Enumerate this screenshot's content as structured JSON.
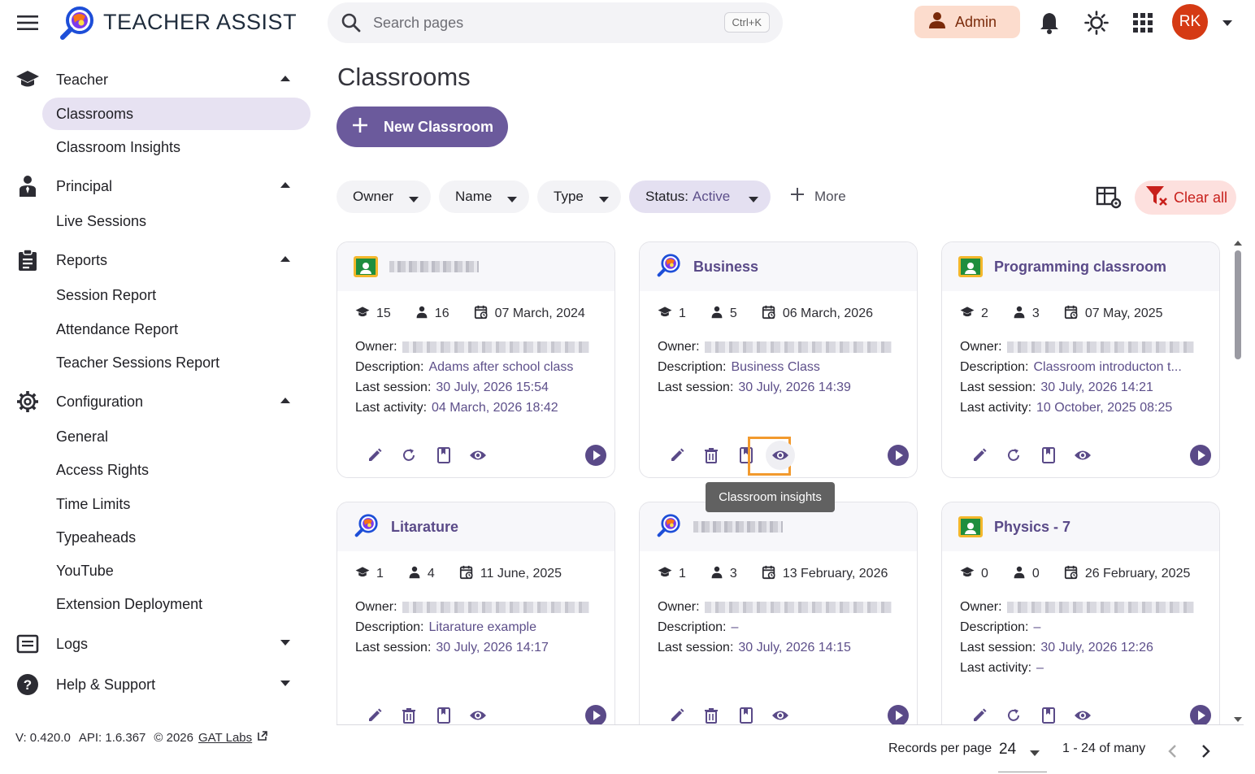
{
  "app": {
    "title": "TEACHER ASSIST",
    "search_placeholder": "Search pages",
    "search_shortcut": "Ctrl+K",
    "role_label": "Admin",
    "avatar_initials": "RK"
  },
  "sidebar": {
    "sections": [
      {
        "label": "Teacher",
        "icon": "graduation-cap-icon",
        "expanded": true,
        "items": [
          "Classrooms",
          "Classroom Insights"
        ]
      },
      {
        "label": "Principal",
        "icon": "person-icon",
        "expanded": true,
        "items": [
          "Live Sessions"
        ]
      },
      {
        "label": "Reports",
        "icon": "clipboard-icon",
        "expanded": true,
        "items": [
          "Session Report",
          "Attendance Report",
          "Teacher Sessions Report"
        ]
      },
      {
        "label": "Configuration",
        "icon": "gear-icon",
        "expanded": true,
        "items": [
          "General",
          "Access Rights",
          "Time Limits",
          "Typeaheads",
          "YouTube",
          "Extension Deployment"
        ]
      },
      {
        "label": "Logs",
        "icon": "list-box-icon",
        "expanded": false,
        "items": []
      },
      {
        "label": "Help & Support",
        "icon": "help-circle-icon",
        "expanded": false,
        "items": []
      }
    ],
    "active_item": "Classrooms",
    "version": "V: 0.420.0",
    "api": "API: 1.6.367",
    "copyright": "© 2026",
    "company": "GAT Labs"
  },
  "main": {
    "title": "Classrooms",
    "new_button": "New Classroom",
    "filters": [
      {
        "label": "Owner"
      },
      {
        "label": "Name"
      },
      {
        "label": "Type"
      },
      {
        "label": "Status:",
        "value": "Active"
      }
    ],
    "more_label": "More",
    "clear_all_label": "Clear all",
    "tooltip": "Classroom insights"
  },
  "cards": [
    {
      "title": "",
      "redacted": true,
      "type": "google",
      "classes": "15",
      "students": "16",
      "date": "07 March, 2024",
      "owner_label": "Owner:",
      "description_label": "Description:",
      "description": "Adams after school class",
      "last_session_label": "Last session:",
      "last_session": "30 July, 2026 15:54",
      "last_activity_label": "Last activity:",
      "last_activity": "04 March, 2026 18:42",
      "second_action": "refresh"
    },
    {
      "title": "Business",
      "redacted": false,
      "type": "local",
      "classes": "1",
      "students": "5",
      "date": "06 March, 2026",
      "owner_label": "Owner:",
      "description_label": "Description:",
      "description": "Business Class",
      "last_session_label": "Last session:",
      "last_session": "30 July, 2026 14:39",
      "last_activity_label": "",
      "last_activity": "",
      "second_action": "delete"
    },
    {
      "title": "Programming classroom",
      "redacted": false,
      "type": "google",
      "classes": "2",
      "students": "3",
      "date": "07 May, 2025",
      "owner_label": "Owner:",
      "description_label": "Description:",
      "description": "Classroom introducton t...",
      "last_session_label": "Last session:",
      "last_session": "30 July, 2026 14:21",
      "last_activity_label": "Last activity:",
      "last_activity": "10 October, 2025 08:25",
      "second_action": "refresh"
    },
    {
      "title": "Litarature",
      "redacted": false,
      "type": "local",
      "classes": "1",
      "students": "4",
      "date": "11 June, 2025",
      "owner_label": "Owner:",
      "description_label": "Description:",
      "description": "Litarature example",
      "last_session_label": "Last session:",
      "last_session": "30 July, 2026 14:17",
      "last_activity_label": "",
      "last_activity": "",
      "second_action": "delete"
    },
    {
      "title": "",
      "redacted": true,
      "type": "local",
      "classes": "1",
      "students": "3",
      "date": "13 February, 2026",
      "owner_label": "Owner:",
      "description_label": "Description:",
      "description": "–",
      "last_session_label": "Last session:",
      "last_session": "30 July, 2026 14:15",
      "last_activity_label": "",
      "last_activity": "",
      "second_action": "delete"
    },
    {
      "title": "Physics - 7",
      "redacted": false,
      "type": "google",
      "classes": "0",
      "students": "0",
      "date": "26 February, 2025",
      "owner_label": "Owner:",
      "description_label": "Description:",
      "description": "–",
      "last_session_label": "Last session:",
      "last_session": "30 July, 2026 12:26",
      "last_activity_label": "Last activity:",
      "last_activity": "–",
      "second_action": "refresh"
    }
  ],
  "pagination": {
    "records_label": "Records per page",
    "per_page": "24",
    "range": "1 - 24 of many"
  },
  "colors": {
    "accent": "#6b5a9c",
    "highlight": "#f29a2e",
    "avatar": "#d53a14"
  }
}
